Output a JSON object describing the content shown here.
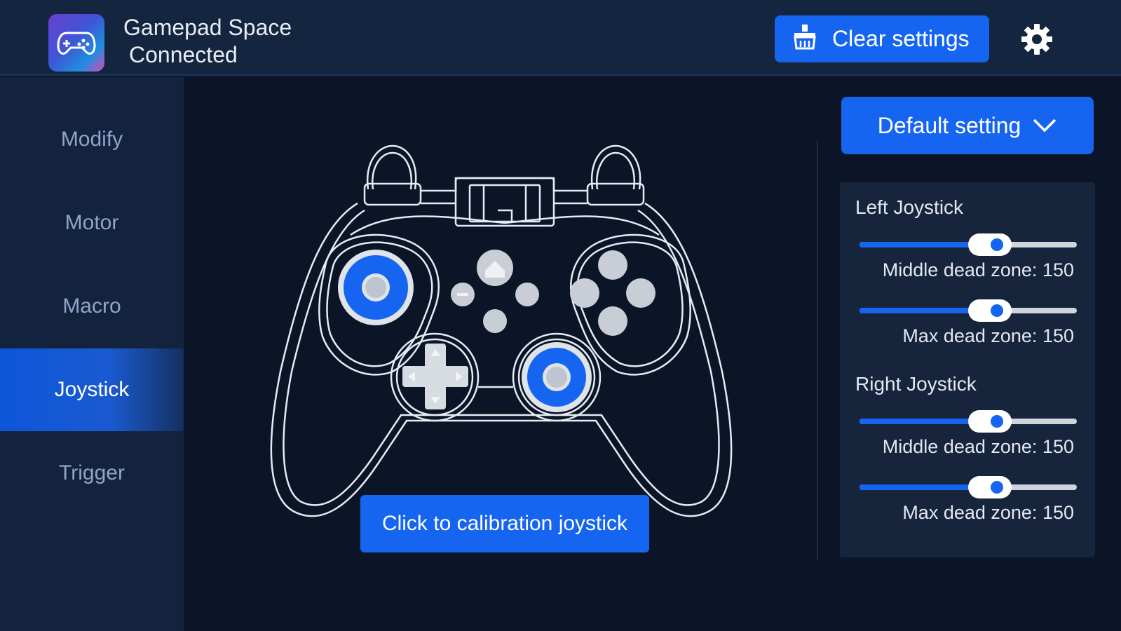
{
  "header": {
    "app_name": "Gamepad Space",
    "status": "Connected",
    "clear_label": "Clear settings"
  },
  "sidebar": {
    "items": [
      {
        "label": "Modify",
        "active": false
      },
      {
        "label": "Motor",
        "active": false
      },
      {
        "label": "Macro",
        "active": false
      },
      {
        "label": "Joystick",
        "active": true
      },
      {
        "label": "Trigger",
        "active": false
      }
    ]
  },
  "main": {
    "calibrate_label": "Click to calibration joystick",
    "preset_label": "Default setting"
  },
  "joystick_settings": {
    "left": {
      "title": "Left Joystick",
      "middle_label": "Middle dead zone: 150",
      "middle_value": 0.6,
      "max_label": "Max dead zone: 150",
      "max_value": 0.6
    },
    "right": {
      "title": "Right Joystick",
      "middle_label": "Middle dead zone: 150",
      "middle_value": 0.6,
      "max_label": "Max dead zone: 150",
      "max_value": 0.6
    }
  },
  "colors": {
    "accent": "#1565f0",
    "background": "#0b1527",
    "sidebar": "#13233d",
    "panel": "#16243c"
  },
  "icons": {
    "logo": "gamepad-logo-icon",
    "clear": "broom-icon",
    "settings": "gear-icon",
    "dropdown": "chevron-down-icon"
  }
}
